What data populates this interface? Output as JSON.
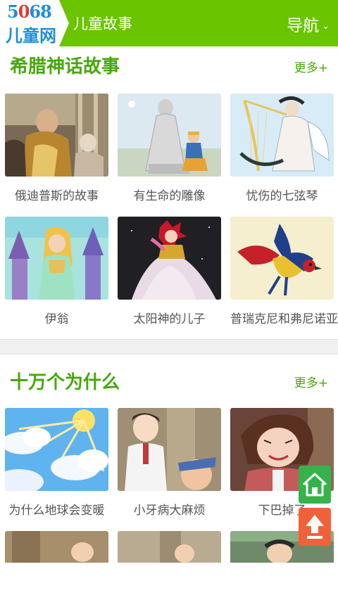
{
  "header": {
    "logo_num_a": "5",
    "logo_num_b": "0",
    "logo_num_c": "68",
    "logo_text": "儿童网",
    "site_title": "儿童故事",
    "nav_label": "导航",
    "nav_icon": "chevron-down-icon"
  },
  "section1": {
    "title": "希腊神话故事",
    "more": "更多+",
    "items": [
      {
        "caption": "俄迪普斯的故事"
      },
      {
        "caption": "有生命的雕像"
      },
      {
        "caption": "忧伤的七弦琴"
      },
      {
        "caption": "伊翁"
      },
      {
        "caption": "太阳神的儿子"
      },
      {
        "caption": "普瑞克尼和弗尼诺亚"
      }
    ]
  },
  "section2": {
    "title": "十万个为什么",
    "more": "更多+",
    "items": [
      {
        "caption": "为什么地球会变暖"
      },
      {
        "caption": "小牙病大麻烦"
      },
      {
        "caption": "下巴掉了"
      }
    ]
  },
  "floating": {
    "home_icon": "home-icon",
    "top_icon": "arrow-up-icon",
    "home_color": "#35b34a",
    "top_color": "#f0613a"
  },
  "colors": {
    "brand_green": "#6ac400",
    "title_green": "#46a80a"
  }
}
